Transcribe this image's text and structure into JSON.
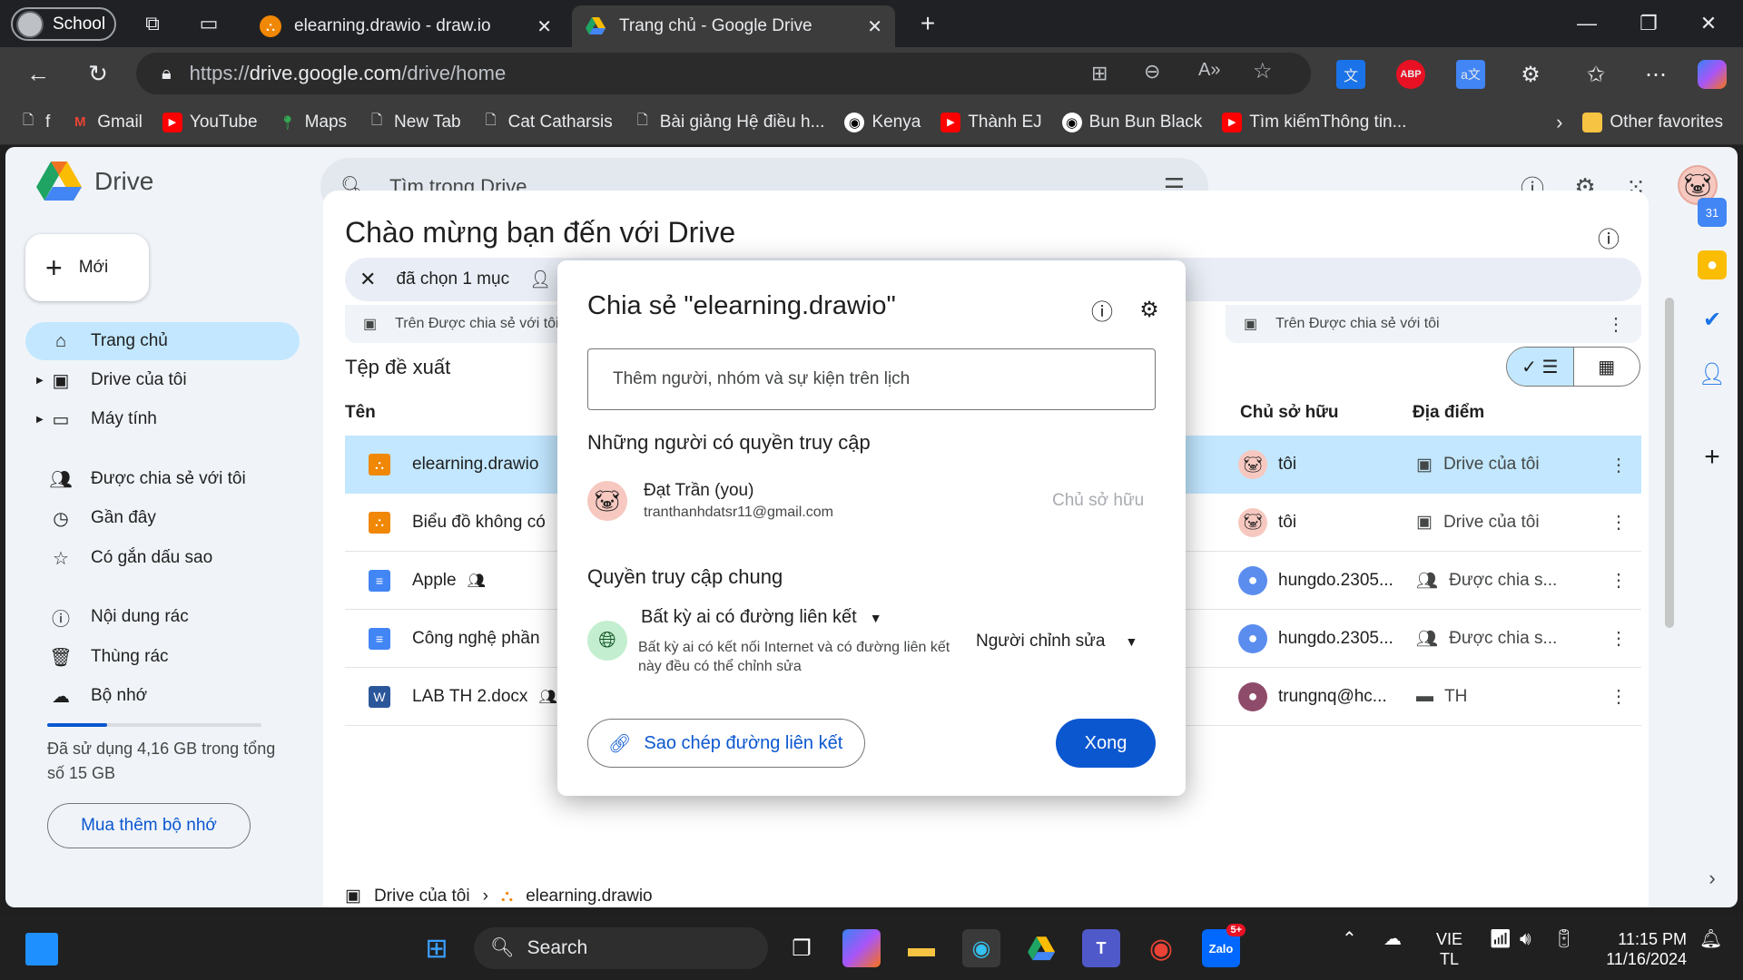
{
  "browser": {
    "profile_label": "School",
    "tabs": [
      {
        "title": "elearning.drawio - draw.io",
        "active": false
      },
      {
        "title": "Trang chủ - Google Drive",
        "active": true
      }
    ],
    "url_prefix": "https://",
    "url_host": "drive.google.com",
    "url_path": "/drive/home",
    "bookmarks": [
      "f",
      "Gmail",
      "YouTube",
      "Maps",
      "New Tab",
      "Cat Catharsis",
      "Bài giảng Hệ điều h...",
      "Kenya",
      "Thành EJ",
      "Bun Bun Black",
      "Tìm kiếmThông tin..."
    ],
    "other_favorites": "Other favorites"
  },
  "drive": {
    "app_name": "Drive",
    "search_placeholder": "Tìm trong Drive",
    "new_label": "Mới",
    "nav": {
      "home": "Trang chủ",
      "my_drive": "Drive của tôi",
      "computers": "Máy tính",
      "shared": "Được chia sẻ với tôi",
      "recent": "Gần đây",
      "starred": "Có gắn dấu sao",
      "spam": "Nội dung rác",
      "trash": "Thùng rác",
      "storage": "Bộ nhớ"
    },
    "storage_text": "Đã sử dụng 4,16 GB trong tổng số 15 GB",
    "storage_fraction": 0.28,
    "buy_storage": "Mua thêm bộ nhớ",
    "welcome": "Chào mừng bạn đến với Drive",
    "selection_text": "đã chọn 1 mục",
    "card_left_sub": "Trên Được chia sẻ với tôi",
    "card_right_sub": "Trên Được chia sẻ với tôi",
    "suggested_title": "Tệp đề xuất",
    "columns": {
      "name": "Tên",
      "owner": "Chủ sở hữu",
      "location": "Địa điểm"
    },
    "rows": [
      {
        "name": "elearning.drawio",
        "owner": "tôi",
        "location": "Drive của tôi"
      },
      {
        "name": "Biểu đồ không có",
        "owner": "tôi",
        "location": "Drive của tôi"
      },
      {
        "name": "Apple",
        "owner": "hungdo.2305...",
        "location": "Được chia s..."
      },
      {
        "name": "Công nghệ phần",
        "owner": "hungdo.2305...",
        "location": "Được chia s..."
      },
      {
        "name": "LAB TH 2.docx",
        "owner": "trungnq@hc...",
        "location": "TH"
      }
    ],
    "breadcrumb": {
      "root": "Drive của tôi",
      "file": "elearning.drawio"
    }
  },
  "share_dialog": {
    "title": "Chia sẻ \"elearning.drawio\"",
    "add_placeholder": "Thêm người, nhóm và sự kiện trên lịch",
    "people_heading": "Những người có quyền truy cập",
    "person_name": "Đạt Trần (you)",
    "person_email": "tranthanhdatsr11@gmail.com",
    "person_role": "Chủ sở hữu",
    "general_heading": "Quyền truy cập chung",
    "access_option": "Bất kỳ ai có đường liên kết",
    "access_desc": "Bất kỳ ai có kết nối Internet và có đường liên kết này đều có thể chỉnh sửa",
    "role_option": "Người chỉnh sửa",
    "copy_link": "Sao chép đường liên kết",
    "done": "Xong"
  },
  "taskbar": {
    "search_label": "Search",
    "lang_top": "VIE",
    "lang_bottom": "TL",
    "time": "11:15 PM",
    "date": "11/16/2024",
    "zalo_badge": "5+"
  }
}
